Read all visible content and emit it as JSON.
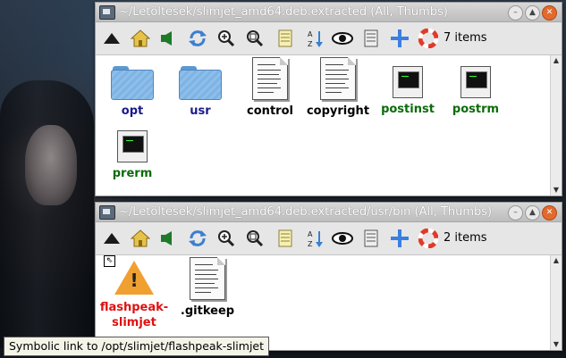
{
  "desktop": {
    "wallpaper": "dark-portrait-wallpaper"
  },
  "window1": {
    "title": "~/Letöltések/slimjet_amd64.deb.extracted (All, Thumbs)",
    "item_count": "7 items",
    "items": [
      {
        "label": "opt",
        "kind": "folder",
        "color": "#1a1a8c"
      },
      {
        "label": "usr",
        "kind": "folder",
        "color": "#1a1a8c"
      },
      {
        "label": "control",
        "kind": "text-document",
        "color": "#000000"
      },
      {
        "label": "copyright",
        "kind": "text-document",
        "color": "#000000"
      },
      {
        "label": "postinst",
        "kind": "executable",
        "color": "#0b6b0b"
      },
      {
        "label": "postrm",
        "kind": "executable",
        "color": "#0b6b0b"
      },
      {
        "label": "prerm",
        "kind": "executable",
        "color": "#0b6b0b"
      }
    ]
  },
  "window2": {
    "title": "~/Letöltések/slimjet_amd64.deb.extracted/usr/bin (All, Thumbs)",
    "item_count": "2 items",
    "items": [
      {
        "label_line1": "flashpeak-",
        "label_line2": "slimjet",
        "kind": "broken-symlink",
        "color": "#e01010"
      },
      {
        "label": ".gitkeep",
        "kind": "text-document",
        "color": "#000000"
      }
    ]
  },
  "toolbar_icons": [
    "up-arrow-icon",
    "home-icon",
    "speaker-icon",
    "refresh-icon",
    "zoom-in-icon",
    "zoom-fit-icon",
    "notes-icon",
    "sort-az-icon",
    "eye-icon",
    "list-icon",
    "add-icon",
    "lifebuoy-icon"
  ],
  "tooltip": {
    "text": "Symbolic link to /opt/slimjet/flashpeak-slimjet"
  }
}
